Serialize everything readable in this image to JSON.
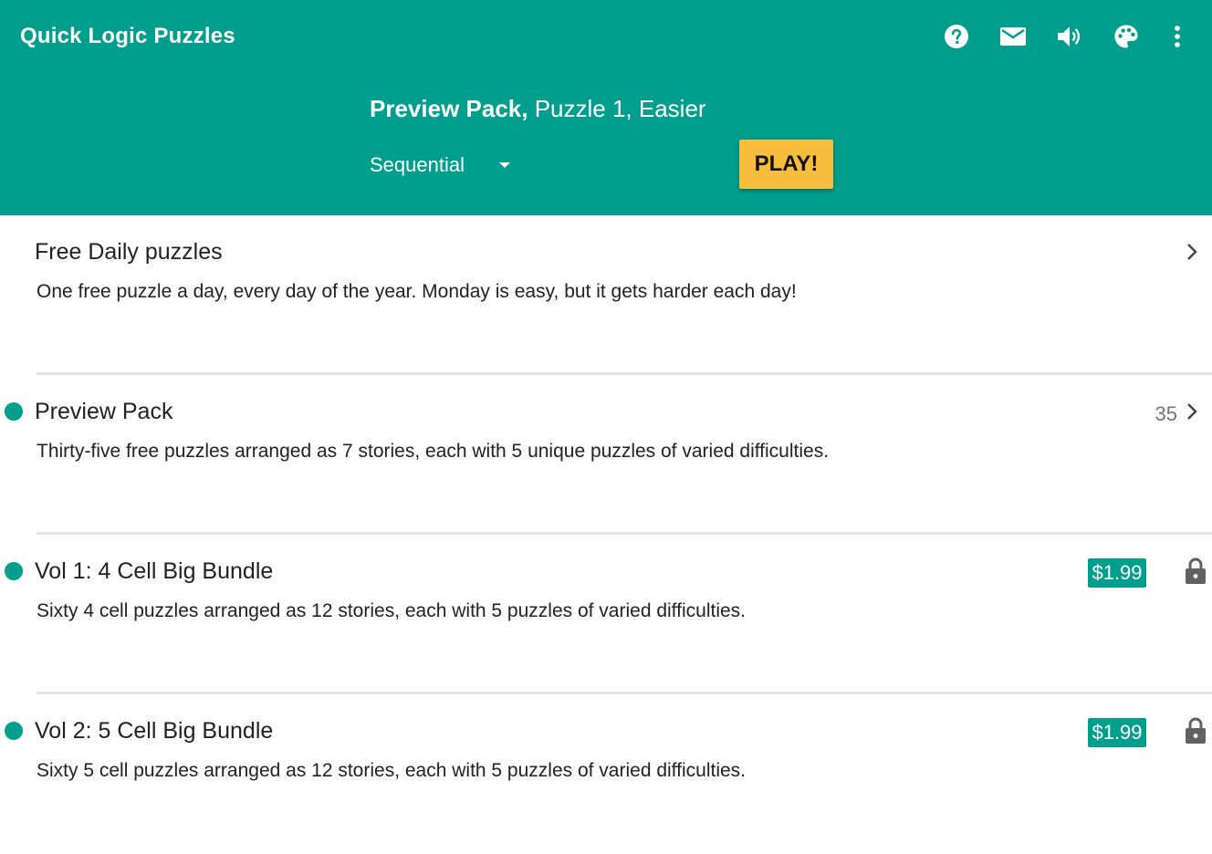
{
  "header": {
    "app_title": "Quick Logic Puzzles",
    "icons": [
      "help-icon",
      "mail-icon",
      "volume-icon",
      "palette-icon",
      "more-vert-icon"
    ],
    "current_pack": "Preview Pack,",
    "current_puzzle": " Puzzle 1, Easier",
    "mode": "Sequential",
    "play_label": "PLAY!"
  },
  "colors": {
    "primary": "#009e8c",
    "accent": "#f8bd3c"
  },
  "list": {
    "items": [
      {
        "title": "Free Daily puzzles",
        "description": "One free puzzle a day, every day of the year. Monday is easy, but it gets harder each day!"
      },
      {
        "title": "Preview Pack",
        "description": "Thirty-five free puzzles arranged as 7 stories, each with 5 unique puzzles of varied difficulties.",
        "count": "35"
      },
      {
        "title": "Vol 1: 4 Cell Big Bundle",
        "description": "Sixty 4 cell puzzles arranged as 12 stories, each with 5 puzzles of varied difficulties.",
        "price": "$1.99"
      },
      {
        "title": "Vol 2: 5 Cell Big Bundle",
        "description": "Sixty 5 cell puzzles arranged as 12 stories, each with 5 puzzles of varied difficulties.",
        "price": "$1.99"
      }
    ]
  }
}
